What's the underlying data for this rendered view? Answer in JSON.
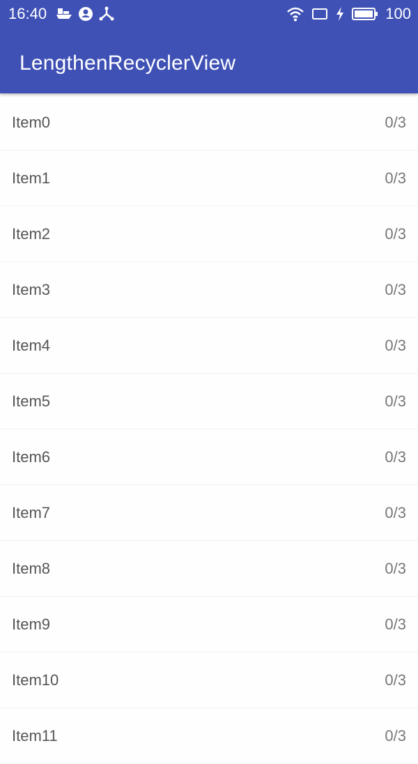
{
  "status_bar": {
    "time": "16:40",
    "battery_level": "100",
    "left_icons": [
      "boat-icon",
      "account-icon",
      "tri-node-icon"
    ],
    "right_icons": [
      "wifi-icon",
      "tablet-icon",
      "charging-icon",
      "battery-icon"
    ]
  },
  "toolbar": {
    "title": "LengthenRecyclerView",
    "color": "#3f51b5"
  },
  "list": {
    "items": [
      {
        "label": "Item0",
        "count": "0/3"
      },
      {
        "label": "Item1",
        "count": "0/3"
      },
      {
        "label": "Item2",
        "count": "0/3"
      },
      {
        "label": "Item3",
        "count": "0/3"
      },
      {
        "label": "Item4",
        "count": "0/3"
      },
      {
        "label": "Item5",
        "count": "0/3"
      },
      {
        "label": "Item6",
        "count": "0/3"
      },
      {
        "label": "Item7",
        "count": "0/3"
      },
      {
        "label": "Item8",
        "count": "0/3"
      },
      {
        "label": "Item9",
        "count": "0/3"
      },
      {
        "label": "Item10",
        "count": "0/3"
      },
      {
        "label": "Item11",
        "count": "0/3"
      }
    ]
  }
}
